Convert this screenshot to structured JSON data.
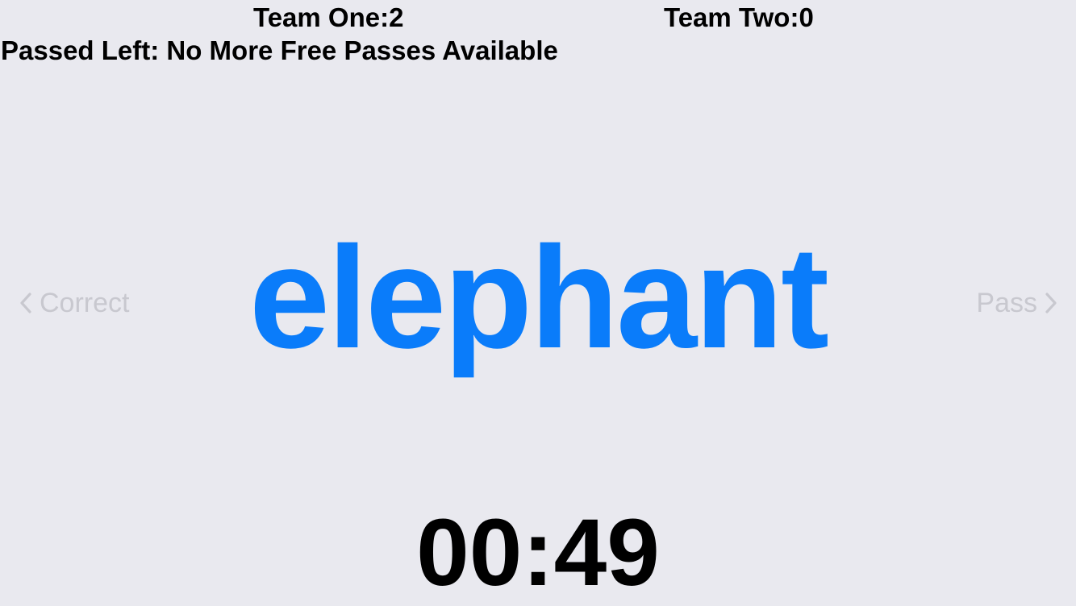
{
  "scoreboard": {
    "team_one": "Team One:2",
    "team_two": "Team Two:0"
  },
  "passes": {
    "status": "Passed Left: No More Free Passes Available"
  },
  "card": {
    "word": "elephant"
  },
  "controls": {
    "correct_label": "Correct",
    "correct_icon": "chevron-left-icon",
    "pass_label": "Pass",
    "pass_icon": "chevron-right-icon"
  },
  "timer": {
    "time": "00:49"
  },
  "colors": {
    "background": "#e9e9ef",
    "word": "#0a7cfa",
    "control_inactive": "#c8c8cf",
    "text": "#000000"
  }
}
